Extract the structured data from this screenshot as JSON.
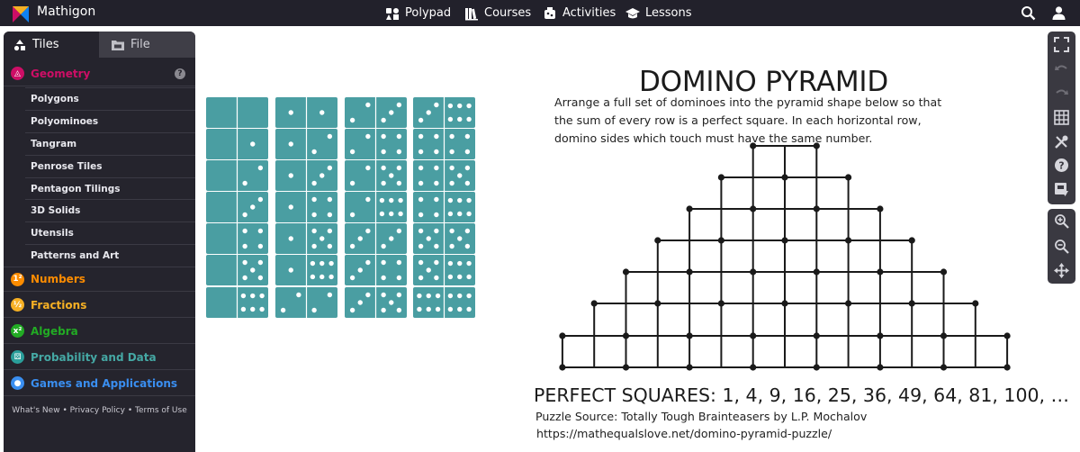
{
  "app": {
    "brand": "Mathigon",
    "nav": [
      {
        "label": "Polypad",
        "icon": "polypad-icon"
      },
      {
        "label": "Courses",
        "icon": "courses-icon"
      },
      {
        "label": "Activities",
        "icon": "activities-icon"
      },
      {
        "label": "Lessons",
        "icon": "lessons-icon"
      }
    ],
    "right_icons": [
      "search-icon",
      "user-icon"
    ]
  },
  "sidebar": {
    "tabs": [
      {
        "label": "Tiles",
        "icon": "tiles-icon",
        "active": true
      },
      {
        "label": "File",
        "icon": "file-icon",
        "active": false
      }
    ],
    "categories": [
      {
        "label": "Geometry",
        "color": "#cd0e66",
        "icon": "geometry-icon",
        "expanded": true
      },
      {
        "label": "Numbers",
        "color": "#fd8c00",
        "icon": "numbers-icon"
      },
      {
        "label": "Fractions",
        "color": "#f6b024",
        "icon": "fractions-icon"
      },
      {
        "label": "Algebra",
        "color": "#22ab24",
        "icon": "algebra-icon"
      },
      {
        "label": "Probability and Data",
        "color": "#0f82f2",
        "icon": "probability-icon"
      },
      {
        "label": "Games and Applications",
        "color": "#3a8ef0",
        "icon": "games-icon"
      }
    ],
    "geometry_items": [
      "Polygons",
      "Polyominoes",
      "Tangram",
      "Penrose Tiles",
      "Pentagon Tilings",
      "3D Solids",
      "Utensils",
      "Patterns and Art"
    ],
    "footer": {
      "whats_new": "What's New",
      "privacy": "Privacy Policy",
      "terms": "Terms of Use",
      "separator": "•"
    }
  },
  "toolbar": {
    "tools": [
      "fullscreen-icon",
      "undo-icon",
      "redo-icon",
      "grid-icon",
      "tools-icon",
      "help-icon",
      "export-icon"
    ],
    "zoom": [
      "zoom-in-icon",
      "zoom-out-icon",
      "pan-icon"
    ]
  },
  "canvas": {
    "title": "DOMINO PYRAMID",
    "intro": "Arrange a full set of dominoes into the pyramid shape below so that the sum of every row is a perfect square. In each horizontal row, domino sides which touch must have the same number.",
    "perfect_squares": "PERFECT SQUARES: 1, 4, 9, 16, 25, 36, 49, 64, 81, 100, …",
    "source": "Puzzle Source: Totally Tough Brainteasers by L.P. Mochalov",
    "url": "https://mathequalslove.net/domino-pyramid-puzzle/",
    "domino_color": "#4a9ea2",
    "dominoes": [
      [
        [
          0,
          0
        ],
        [
          0,
          1
        ],
        [
          0,
          2
        ],
        [
          0,
          3
        ],
        [
          0,
          4
        ],
        [
          0,
          5
        ],
        [
          0,
          6
        ]
      ],
      [
        [
          1,
          1
        ],
        [
          1,
          2
        ],
        [
          1,
          3
        ],
        [
          1,
          4
        ],
        [
          1,
          5
        ],
        [
          1,
          6
        ],
        [
          2,
          2
        ]
      ],
      [
        [
          2,
          3
        ],
        [
          2,
          4
        ],
        [
          2,
          5
        ],
        [
          2,
          6
        ],
        [
          3,
          3
        ],
        [
          3,
          4
        ],
        [
          3,
          5
        ]
      ],
      [
        [
          3,
          6
        ],
        [
          4,
          4
        ],
        [
          4,
          5
        ],
        [
          4,
          6
        ],
        [
          5,
          5
        ],
        [
          5,
          6
        ],
        [
          6,
          6
        ]
      ]
    ]
  }
}
